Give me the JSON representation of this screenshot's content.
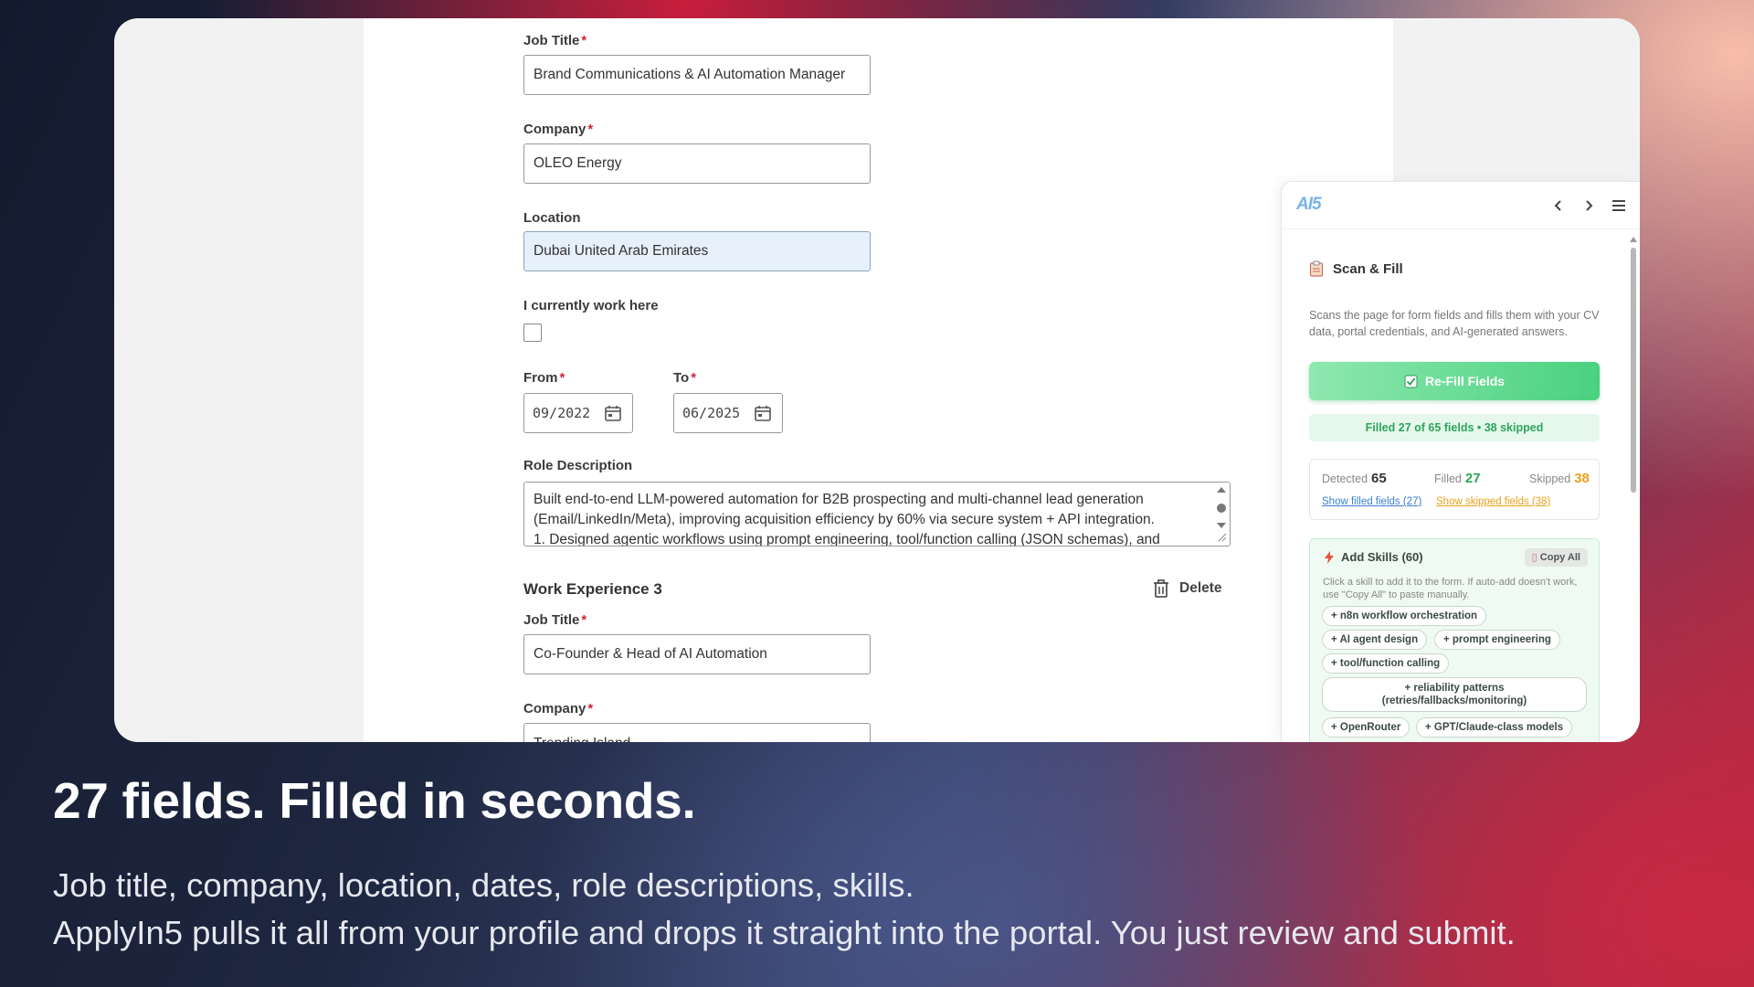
{
  "form": {
    "job_title_label": "Job Title",
    "job_title_value": "Brand Communications & AI Automation Manager",
    "company_label": "Company",
    "company_value": "OLEO Energy",
    "location_label": "Location",
    "location_value": "Dubai United Arab Emirates",
    "currently_label": "I currently work here",
    "currently_checked": false,
    "from_label": "From",
    "from_value": "09/2022",
    "to_label": "To",
    "to_value": "06/2025",
    "role_desc_label": "Role Description",
    "role_desc_line1": "Built end-to-end LLM-powered automation for B2B prospecting and multi-channel lead generation",
    "role_desc_line2": "(Email/LinkedIn/Meta), improving acquisition efficiency by 60% via secure system + API integration.",
    "role_desc_line3": "1. Designed agentic workflows using prompt engineering, tool/function calling (JSON schemas), and",
    "required_mark": "*",
    "section3_title": "Work Experience 3",
    "delete_label": "Delete",
    "job_title3_label": "Job Title",
    "job_title3_value": "Co-Founder & Head of AI Automation",
    "company3_label": "Company",
    "company3_value": "Trending Island"
  },
  "panel": {
    "logo": "AI5",
    "scan_title": "Scan & Fill",
    "scan_desc": "Scans the page for form fields and fills them with your CV data, portal credentials, and AI-generated answers.",
    "refill_label": "Re-Fill Fields",
    "status_text": "Filled 27 of 65 fields • 38 skipped",
    "detected_label": "Detected",
    "detected_value": "65",
    "filled_label": "Filled",
    "filled_value": "27",
    "skipped_label": "Skipped",
    "skipped_value": "38",
    "show_filled": "Show filled fields (27)",
    "show_skipped": "Show skipped fields (38)",
    "skills_title": "Add Skills (60)",
    "copy_all": "Copy All",
    "skills_hint": "Click a skill to add it to the form. If auto-add doesn't work, use \"Copy All\" to paste manually.",
    "chips": [
      "+ n8n workflow orchestration",
      "+ AI agent design",
      "+ prompt engineering",
      "+ tool/function calling",
      "+ reliability patterns (retries/fallbacks/monitoring)",
      "+ OpenRouter",
      "+ GPT/Claude-class models"
    ]
  },
  "caption": {
    "headline": "27 fields. Filled in seconds.",
    "line1": "Job title, company, location, dates, role descriptions, skills.",
    "line2": "ApplyIn5 pulls it all from your profile and drops it straight into the portal. You just review and submit."
  },
  "colors": {
    "accent_green": "#4ad17f",
    "filled_green": "#2ea55b",
    "skipped_orange": "#e8a21a",
    "link_blue": "#3a7fd6",
    "required_red": "#d0253b"
  }
}
